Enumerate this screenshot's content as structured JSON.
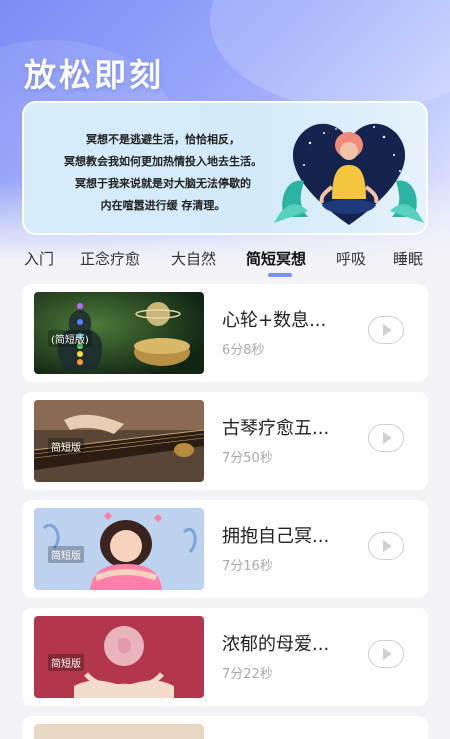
{
  "header": {
    "title": "放松即刻"
  },
  "banner": {
    "lines": [
      "冥想不是逃避生活，恰恰相反，",
      "冥想教会我如何更加热情投入地去生活。",
      "冥想于我来说就是对大脑无法停歇的",
      "内在喧嚣进行缓 存清理。"
    ]
  },
  "tabs": [
    {
      "label": "入门"
    },
    {
      "label": "正念疗愈"
    },
    {
      "label": "大自然"
    },
    {
      "label": "简短冥想",
      "active": true
    },
    {
      "label": "呼吸"
    },
    {
      "label": "睡眠"
    }
  ],
  "items": [
    {
      "title": "心轮+数息...",
      "duration": "6分8秒",
      "badge": "(简短版)"
    },
    {
      "title": "古琴疗愈五...",
      "duration": "7分50秒",
      "badge": "简短版"
    },
    {
      "title": "拥抱自己冥...",
      "duration": "7分16秒",
      "badge": "简短版"
    },
    {
      "title": "浓郁的母爱...",
      "duration": "7分22秒",
      "badge": "简短版"
    }
  ],
  "colors": {
    "accent": "#7d8ef5",
    "header_gradient_start": "#7c8cf5",
    "banner_bg": "#d7ecfa"
  }
}
